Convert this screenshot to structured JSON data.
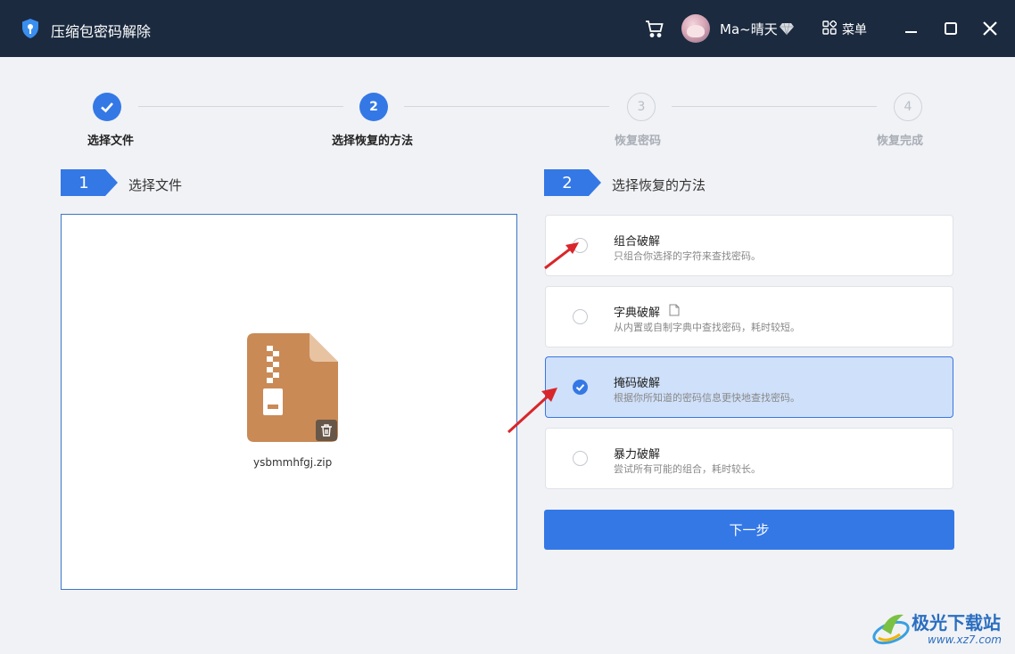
{
  "window": {
    "title": "压缩包密码解除",
    "username": "Ma~晴天",
    "menu_label": "菜单"
  },
  "steps": [
    {
      "number": "1",
      "label": "选择文件",
      "state": "done"
    },
    {
      "number": "2",
      "label": "选择恢复的方法",
      "state": "active"
    },
    {
      "number": "3",
      "label": "恢复密码",
      "state": "pending"
    },
    {
      "number": "4",
      "label": "恢复完成",
      "state": "pending"
    }
  ],
  "left_section": {
    "number": "1",
    "title": "选择文件",
    "file_name": "ysbmmhfgj.zip"
  },
  "right_section": {
    "number": "2",
    "title": "选择恢复的方法",
    "options": [
      {
        "title": "组合破解",
        "desc": "只组合你选择的字符来查找密码。",
        "selected": false
      },
      {
        "title": "字典破解",
        "desc": "从内置或自制字典中查找密码，耗时较短。",
        "selected": false
      },
      {
        "title": "掩码破解",
        "desc": "根据你所知道的密码信息更快地查找密码。",
        "selected": true
      },
      {
        "title": "暴力破解",
        "desc": "尝试所有可能的组合，耗时较长。",
        "selected": false
      }
    ],
    "next_label": "下一步"
  },
  "watermark": {
    "name": "极光下载站",
    "url": "www.xz7.com"
  },
  "colors": {
    "titlebar": "#1b2a3f",
    "accent": "#3478e6",
    "selected_bg": "#cfe0fa",
    "zip_icon": "#c98a56",
    "arrow": "#d9262a"
  }
}
